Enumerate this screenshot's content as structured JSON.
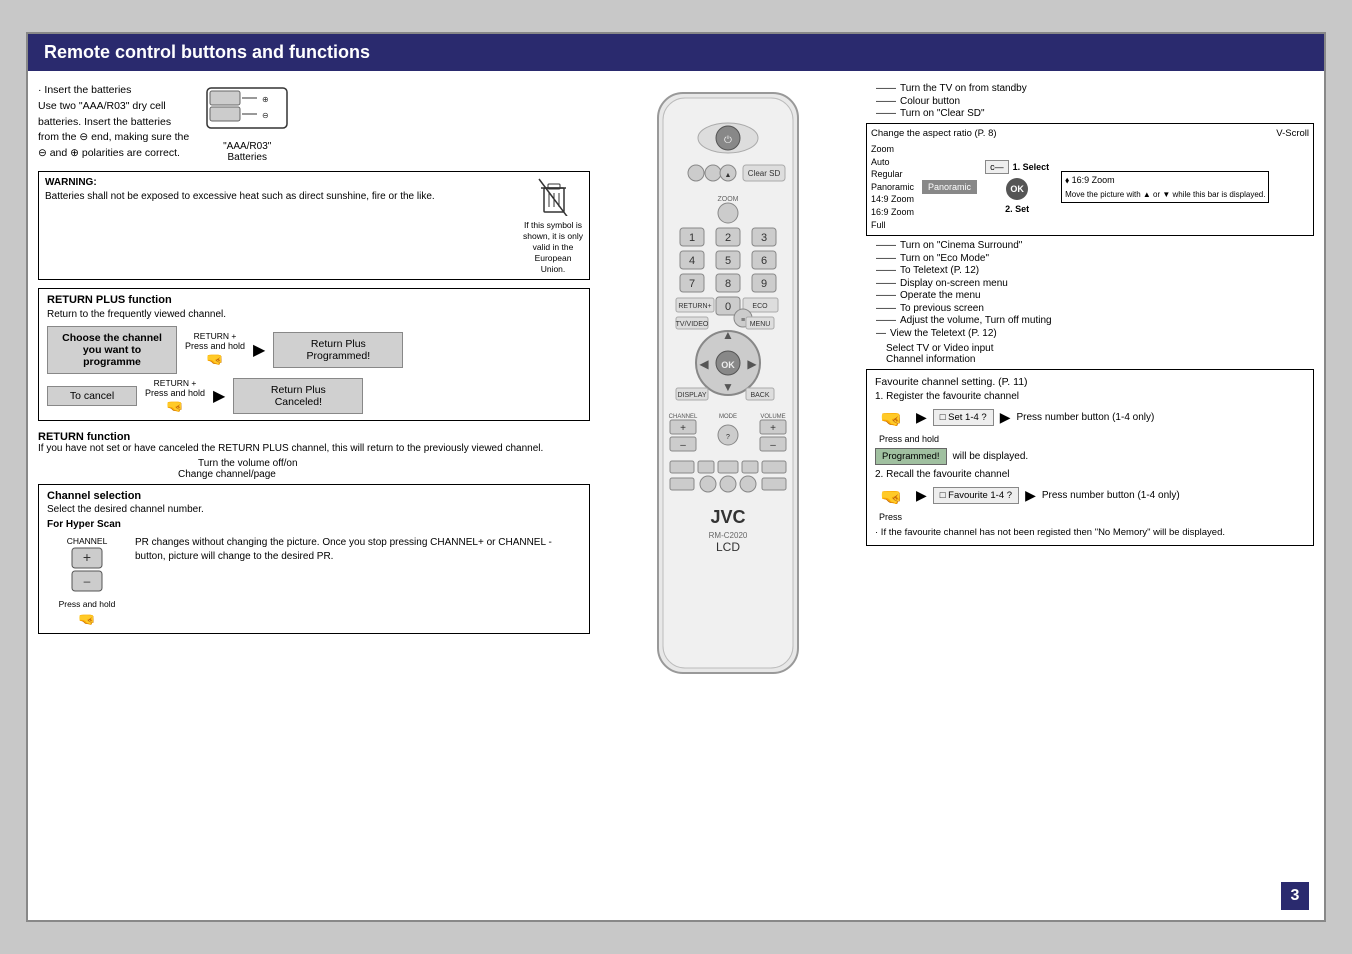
{
  "header": {
    "title": "Remote control buttons and functions"
  },
  "battery_section": {
    "bullet": "·",
    "line1": "Insert the batteries",
    "line2": "Use two \"AAA/R03\" dry cell",
    "line3": "batteries. Insert the batteries",
    "line4": "from the ⊖ end, making sure the",
    "line5": "⊖ and ⊕ polarities are correct.",
    "label": "\"AAA/R03\"",
    "label2": "Batteries"
  },
  "warning": {
    "title": "WARNING:",
    "text": "Batteries shall not be exposed to excessive heat such as direct sunshine, fire or the like.",
    "eu_text": "If this symbol is shown, it is only valid in the European Union."
  },
  "return_plus": {
    "title": "RETURN PLUS function",
    "desc": "Return to the frequently viewed channel.",
    "choose_label": "Choose the channel you want to programme",
    "return_plus_label": "RETURN +",
    "press_hold": "Press and hold",
    "return_plus_label2": "RETURN +",
    "result1": "Return Plus Programmed!",
    "cancel_label": "To cancel",
    "result2": "Return Plus Canceled!",
    "press_hold2": "Press and hold"
  },
  "return_function": {
    "title": "RETURN function",
    "desc": "If you have not set or have canceled the RETURN PLUS channel, this will return to the previously viewed channel."
  },
  "channel_selection": {
    "title": "Channel selection",
    "desc": "Select the desired channel number.",
    "hyper_title": "For Hyper Scan",
    "channel_label": "CHANNEL",
    "hyper_desc": "PR changes without changing the picture. Once you stop pressing CHANNEL+ or CHANNEL - button, picture will change to the desired PR.",
    "press_hold": "Press and hold"
  },
  "right_annotations": {
    "line1": "Turn the TV on from standby",
    "line2": "Colour button",
    "line3": "Turn on \"Clear SD\"",
    "line4": "Change the aspect ratio (P. 8)",
    "line5": "Turn on \"Cinema Surround\"",
    "line6": "Turn on \"Eco Mode\"",
    "line7": "To Teletext (P. 12)",
    "line8": "Display on-screen menu",
    "line9": "Operate the menu",
    "line10": "To previous screen",
    "line11": "Adjust the volume, Turn off muting",
    "line12": "View the Teletext (P. 12)",
    "select_label": "1. Select",
    "set_label": "2. Set",
    "vscroll_label": "V-Scroll",
    "zoom_label": "Zoom",
    "auto_label": "Auto",
    "regular_label": "Regular",
    "panoramic_label": "Panoramic",
    "p149_label": "14:9 Zoom",
    "p169_label": "16:9 Zoom",
    "full_label": "Full",
    "panoramic_btn": "Panoramic",
    "zoom_display": "⬧ 16:9 Zoom",
    "move_text": "Move the picture with ▲ or ▼ while this bar is displayed.",
    "select_tv_video": "Select TV or Video input",
    "channel_info": "Channel information"
  },
  "favourite": {
    "title": "Favourite channel setting. (P. 11)",
    "reg_title": "1. Register the favourite channel",
    "set_label": "□ Set 1-4 ?",
    "press_number": "Press number button (1-4 only)",
    "press_hold": "Press and hold",
    "programmed": "Programmed!",
    "will_display": "will be displayed.",
    "recall_title": "2. Recall the favourite channel",
    "fav_label": "□ Favourite 1-4 ?",
    "press_number2": "Press number button (1-4 only)",
    "press2": "Press",
    "memory_note": "· If the favourite channel has not been registed then \"No Memory\" will be displayed."
  },
  "page_number": "3",
  "remote": {
    "model": "RM-C2020",
    "type": "LCD",
    "brand": "JVC"
  }
}
